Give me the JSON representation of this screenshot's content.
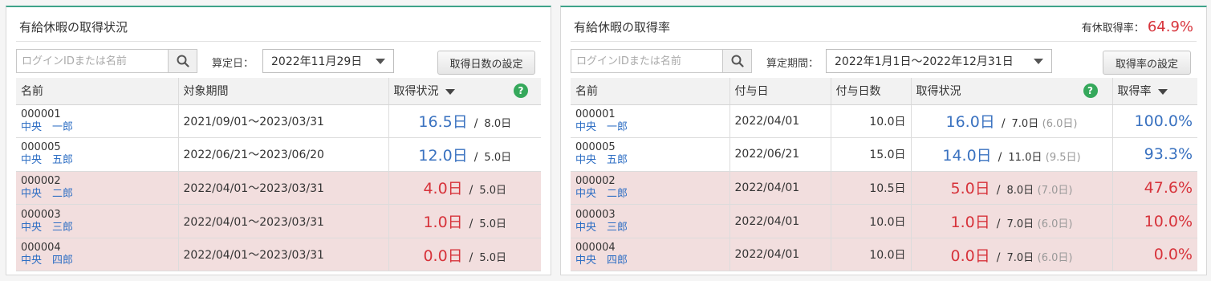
{
  "left": {
    "title": "有給休暇の取得状況",
    "search_placeholder": "ログインIDまたは名前",
    "date_label": "算定日：",
    "date_value": "2022年11月29日",
    "settings_button": "取得日数の設定",
    "columns": {
      "name": "名前",
      "period": "対象期間",
      "status": "取得状況"
    },
    "rows": [
      {
        "id": "000001",
        "name": "中央　一郎",
        "period": "2021/09/01～2023/03/31",
        "taken": "16.5日",
        "required": "8.0日",
        "color": "#3a72c0",
        "highlight": false
      },
      {
        "id": "000005",
        "name": "中央　五郎",
        "period": "2022/06/21～2023/06/20",
        "taken": "12.0日",
        "required": "5.0日",
        "color": "#3a72c0",
        "highlight": false
      },
      {
        "id": "000002",
        "name": "中央　二郎",
        "period": "2022/04/01～2023/03/31",
        "taken": "4.0日",
        "required": "5.0日",
        "color": "#d7333b",
        "highlight": true
      },
      {
        "id": "000003",
        "name": "中央　三郎",
        "period": "2022/04/01～2023/03/31",
        "taken": "1.0日",
        "required": "5.0日",
        "color": "#d7333b",
        "highlight": true
      },
      {
        "id": "000004",
        "name": "中央　四郎",
        "period": "2022/04/01～2023/03/31",
        "taken": "0.0日",
        "required": "5.0日",
        "color": "#d7333b",
        "highlight": true
      }
    ]
  },
  "right": {
    "title": "有給休暇の取得率",
    "rate_label": "有休取得率：",
    "rate_value": "64.9%",
    "search_placeholder": "ログインIDまたは名前",
    "period_label": "算定期間：",
    "period_value": "2022年1月1日～2022年12月31日",
    "settings_button": "取得率の設定",
    "columns": {
      "name": "名前",
      "grant_date": "付与日",
      "grant_days": "付与日数",
      "status": "取得状況",
      "rate": "取得率"
    },
    "rows": [
      {
        "id": "000001",
        "name": "中央　一郎",
        "grant_date": "2022/04/01",
        "grant_days": "10.0日",
        "taken": "16.0日",
        "total": "7.0日",
        "paren": "(6.0日)",
        "rate": "100.0%",
        "color": "#3a72c0",
        "highlight": false
      },
      {
        "id": "000005",
        "name": "中央　五郎",
        "grant_date": "2022/06/21",
        "grant_days": "15.0日",
        "taken": "14.0日",
        "total": "11.0日",
        "paren": "(9.5日)",
        "rate": "93.3%",
        "color": "#3a72c0",
        "highlight": false
      },
      {
        "id": "000002",
        "name": "中央　二郎",
        "grant_date": "2022/04/01",
        "grant_days": "10.5日",
        "taken": "5.0日",
        "total": "8.0日",
        "paren": "(7.0日)",
        "rate": "47.6%",
        "color": "#d7333b",
        "highlight": true
      },
      {
        "id": "000003",
        "name": "中央　三郎",
        "grant_date": "2022/04/01",
        "grant_days": "10.0日",
        "taken": "1.0日",
        "total": "7.0日",
        "paren": "(6.0日)",
        "rate": "10.0%",
        "color": "#d7333b",
        "highlight": true
      },
      {
        "id": "000004",
        "name": "中央　四郎",
        "grant_date": "2022/04/01",
        "grant_days": "10.0日",
        "taken": "0.0日",
        "total": "7.0日",
        "paren": "(6.0日)",
        "rate": "0.0%",
        "color": "#d7333b",
        "highlight": true
      }
    ]
  },
  "colors": {
    "accent": "#3fa38a",
    "positive": "#3a72c0",
    "negative": "#d7333b",
    "warn_row": "#f2dede",
    "name_link": "#2f6fc4"
  },
  "icons": {
    "search": "search-icon",
    "help": "help-icon",
    "dropdown": "chevron-down-icon",
    "sort": "sort-desc-icon"
  }
}
